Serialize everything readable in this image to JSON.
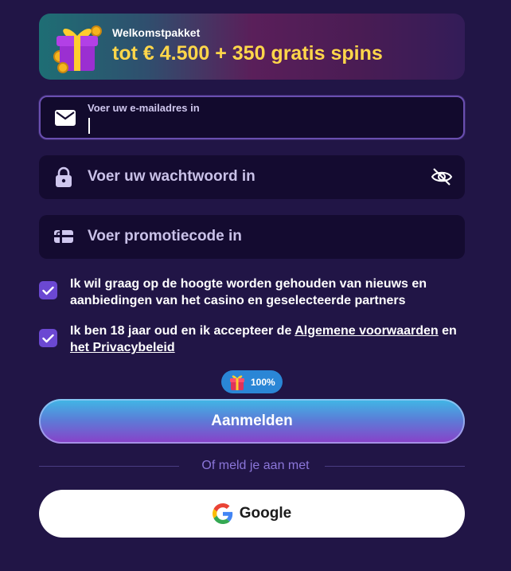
{
  "banner": {
    "title": "Welkomstpakket",
    "offer": "tot € 4.500 + 350 gratis spins"
  },
  "form": {
    "email": {
      "label": "Voer uw e-mailadres in",
      "value": ""
    },
    "password": {
      "placeholder": "Voer uw wachtwoord in"
    },
    "promo": {
      "placeholder": "Voer promotiecode in"
    }
  },
  "consents": {
    "newsletter": {
      "checked": true,
      "text": "Ik wil graag op de hoogte worden gehouden van nieuws en aanbiedingen van het casino en geselecteerde partners"
    },
    "terms": {
      "checked": true,
      "text_before": "Ik ben 18 jaar oud en ik accepteer de",
      "terms_link": "Algemene voorwaarden",
      "text_between": "en",
      "privacy_link": "het Privacybeleid"
    }
  },
  "progress": {
    "value": "100%"
  },
  "submit": {
    "label": "Aanmelden"
  },
  "divider": {
    "text": "Of meld je aan met"
  },
  "social": {
    "google_label": "Google"
  },
  "colors": {
    "background": "#211546",
    "field": "#140b30",
    "checkbox": "#6b48d2",
    "offer": "#ffd64a",
    "badge": "#2a86d6",
    "divider_text": "#8b76d9"
  }
}
